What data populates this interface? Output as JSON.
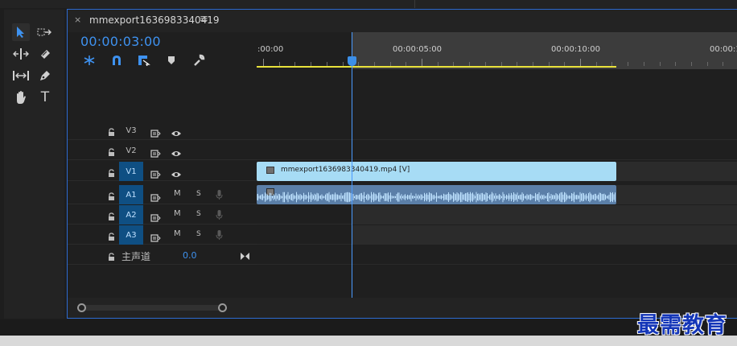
{
  "sequence": {
    "tab_close": "×",
    "title": "mmexport1636983340419",
    "menu_icon": "≡",
    "timecode": "00:00:03:00"
  },
  "ruler": {
    "labels": [
      ":00:00",
      "00:00:05:00",
      "00:00:10:00",
      "00:00:1"
    ]
  },
  "tracks": {
    "video": [
      {
        "name": "V3"
      },
      {
        "name": "V2"
      },
      {
        "name": "V1"
      }
    ],
    "audio": [
      {
        "name": "A1",
        "mute": "M",
        "solo": "S"
      },
      {
        "name": "A2",
        "mute": "M",
        "solo": "S"
      },
      {
        "name": "A3",
        "mute": "M",
        "solo": "S"
      }
    ],
    "master": {
      "label": "主声道",
      "value": "0.0"
    }
  },
  "clips": {
    "video_clip_name": "mmexport1636983340419.mp4 [V]"
  },
  "tools": {
    "text_tool_glyph": "T"
  },
  "colors": {
    "accent": "#3e92f0",
    "work_area_bar": "#e9e23b",
    "video_clip": "#a7dcf5",
    "audio_clip": "#5b7fa8",
    "selected_track": "#0f4f83",
    "watermark": "#1436b8"
  },
  "watermark": "最需教育"
}
